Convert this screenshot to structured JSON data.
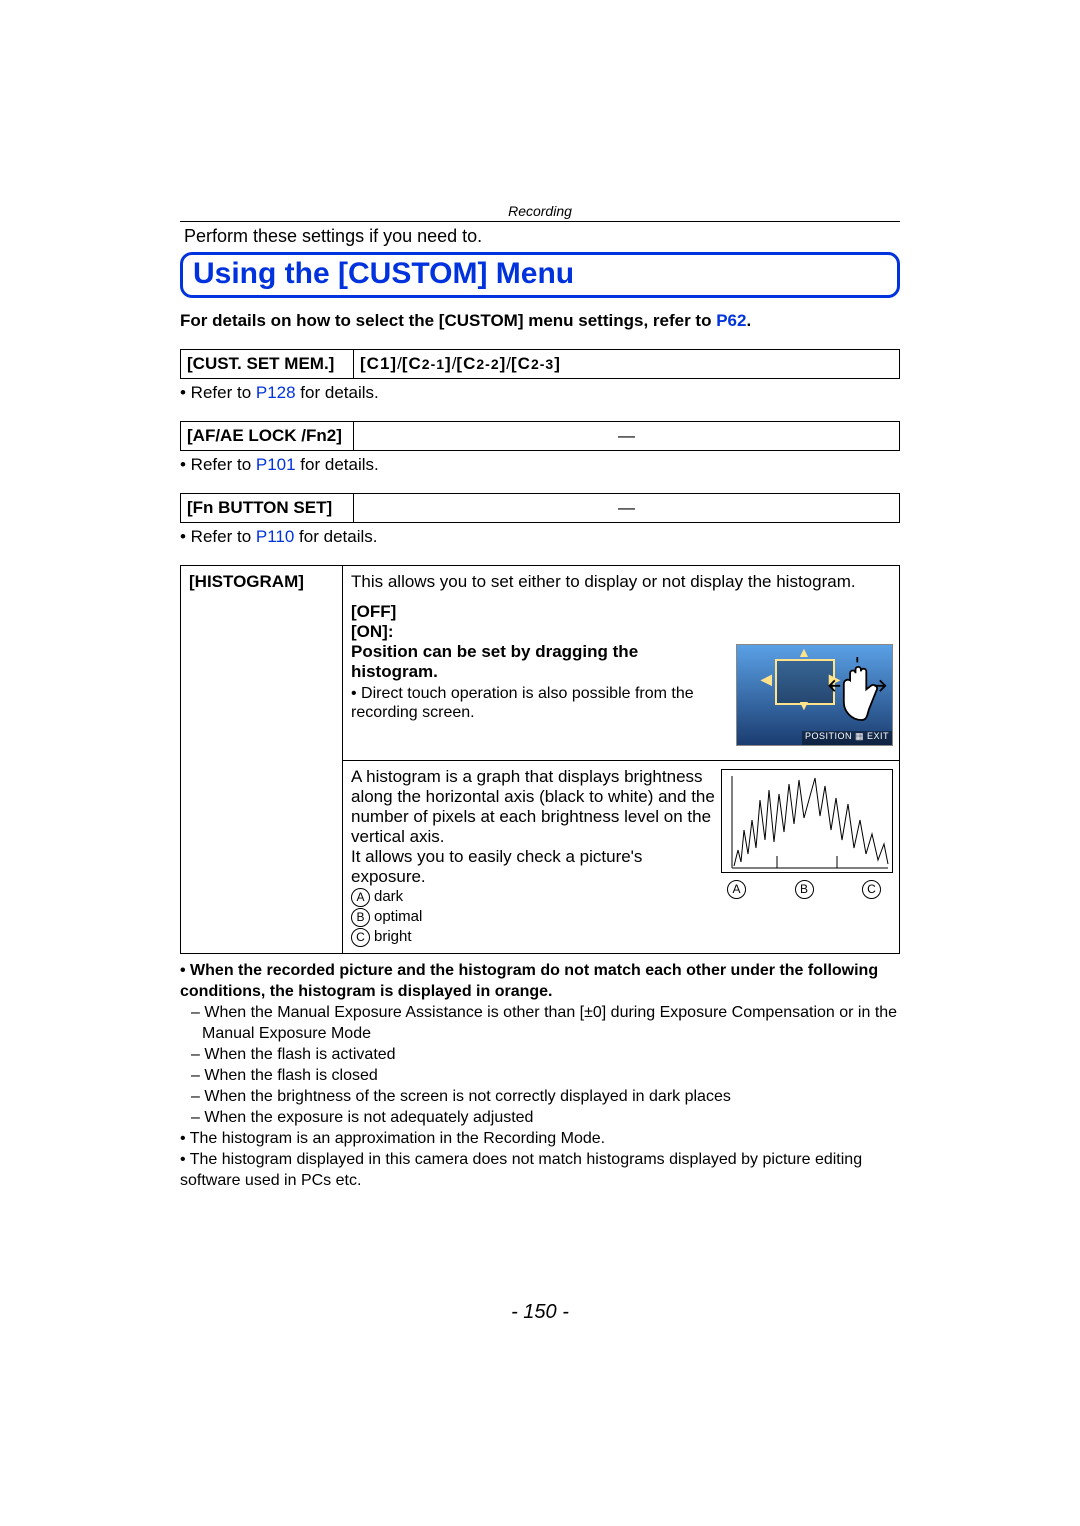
{
  "header": {
    "section": "Recording"
  },
  "intro": "Perform these settings if you need to.",
  "title": "Using the [CUSTOM] Menu",
  "subtext": {
    "pre": "For details on how to select the [CUSTOM] menu settings, refer to ",
    "link": "P62",
    "post": "."
  },
  "rows": {
    "custset": {
      "label": "[CUST. SET MEM.]",
      "value": "[C1]/[C2-1]/[C2-2]/[C2-3]",
      "note_pre": "• Refer to ",
      "note_link": "P128",
      "note_post": " for details."
    },
    "afae": {
      "label": "[AF/AE LOCK /Fn2]",
      "value": "—",
      "note_pre": "• Refer to ",
      "note_link": "P101",
      "note_post": " for details."
    },
    "fnbtn": {
      "label": "[Fn BUTTON SET]",
      "value": "—",
      "note_pre": "• Refer to ",
      "note_link": "P110",
      "note_post": " for details."
    }
  },
  "histogram": {
    "label": "[HISTOGRAM]",
    "top": {
      "desc": "This allows you to set either to display or not display the histogram.",
      "off": "[OFF]",
      "on": "[ON]:",
      "drag": "Position can be set by dragging the histogram.",
      "touch_note": "• Direct touch operation is also possible from the recording screen.",
      "status_position": "POSITION",
      "status_exit": "EXIT"
    },
    "bottom": {
      "desc1": "A histogram is a graph that displays brightness along the horizontal axis (black to white) and the number of pixels at each brightness level on the vertical axis.",
      "desc2": "It allows you to easily check a picture's exposure.",
      "leg_a": "dark",
      "leg_b": "optimal",
      "leg_c": "bright",
      "axisA": "A",
      "axisB": "B",
      "axisC": "C"
    }
  },
  "notes": {
    "n1": "• When the recorded picture and the histogram do not match each other under the following conditions, the histogram is displayed in orange.",
    "n1a": "When the Manual Exposure Assistance is other than [±0] during Exposure Compensation or in the Manual Exposure Mode",
    "n1b": "When the flash is activated",
    "n1c": "When the flash is closed",
    "n1d": "When the brightness of the screen is not correctly displayed in dark places",
    "n1e": "When the exposure is not adequately adjusted",
    "n2": "• The histogram is an approximation in the Recording Mode.",
    "n3": "• The histogram displayed in this camera does not match histograms displayed by picture editing software used in PCs etc."
  },
  "page_number": "- 150 -"
}
